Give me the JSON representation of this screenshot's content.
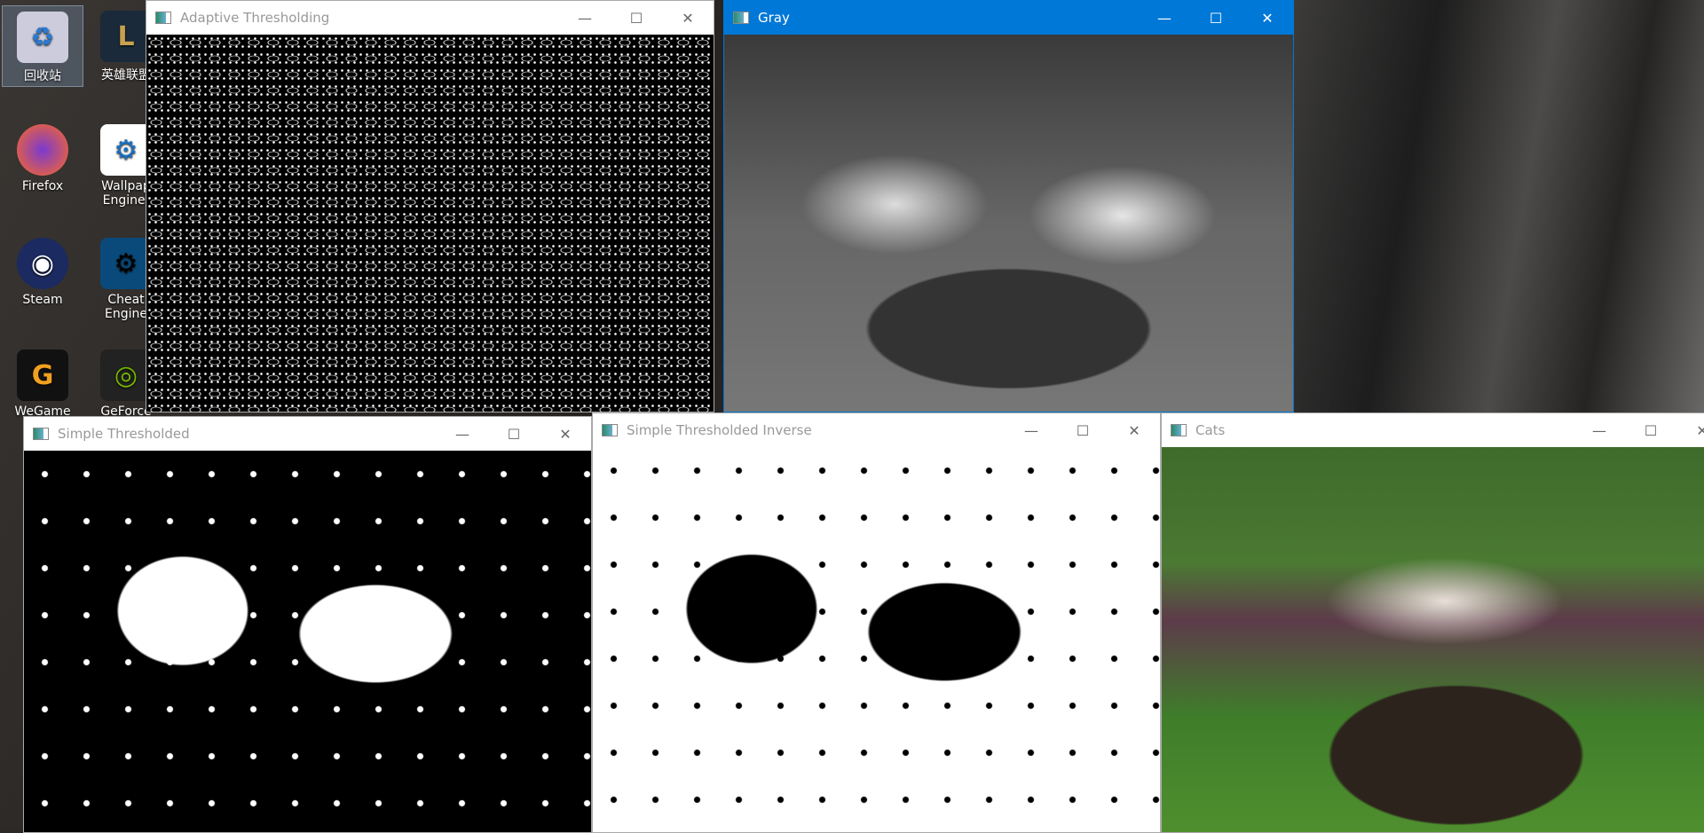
{
  "desktop": {
    "icons": [
      {
        "label": "回收站",
        "icon": "recycle-bin-icon"
      },
      {
        "label": "英雄联盟",
        "icon": "league-of-legends-icon"
      },
      {
        "label": "Firefox",
        "icon": "firefox-icon"
      },
      {
        "label": "Wallpap Engine:",
        "icon": "wallpaper-engine-icon"
      },
      {
        "label": "Steam",
        "icon": "steam-icon"
      },
      {
        "label": "Cheat Engine",
        "icon": "cheat-engine-icon"
      },
      {
        "label": "WeGame",
        "icon": "wegame-icon"
      },
      {
        "label": "GeForce",
        "icon": "nvidia-geforce-icon"
      }
    ]
  },
  "windows": {
    "adaptive": {
      "title": "Adaptive Thresholding"
    },
    "gray": {
      "title": "Gray"
    },
    "simple": {
      "title": "Simple Thresholded"
    },
    "inverse": {
      "title": "Simple Thresholded Inverse"
    },
    "cats": {
      "title": "Cats"
    }
  },
  "controls": {
    "minimize": "—",
    "maximize": "☐",
    "close": "✕"
  },
  "colors": {
    "active_titlebar": "#0078d7"
  }
}
